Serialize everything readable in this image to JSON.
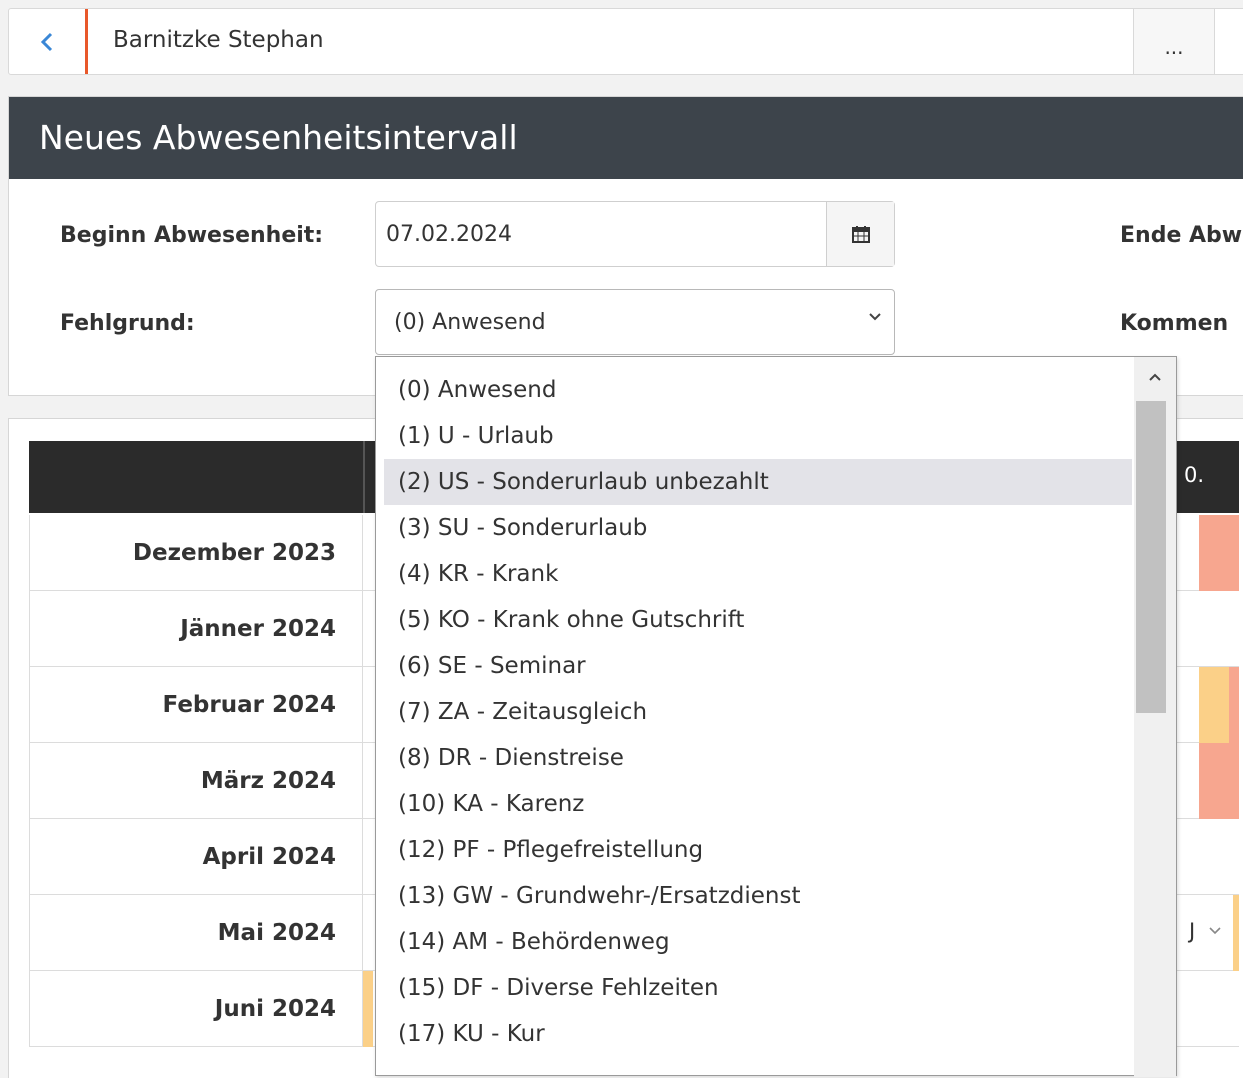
{
  "topbar": {
    "back_icon": "chevron-left-icon",
    "person_name": "Barnitzke Stephan",
    "more_label": "...",
    "accent_color": "#e8582a"
  },
  "dialog": {
    "title": "Neues Abwesenheitsintervall",
    "begin_label": "Beginn Abwesenheit:",
    "begin_value": "07.02.2024",
    "calendar_icon": "calendar-icon",
    "end_label": "Ende Abw",
    "reason_label": "Fehlgrund:",
    "reason_value": "(0) Anwesend",
    "comment_label": "Kommen"
  },
  "table": {
    "header_right_text": "0.",
    "months": [
      {
        "label": "Dezember 2023",
        "color": "#f7a68f"
      },
      {
        "label": "Jänner 2024",
        "color": ""
      },
      {
        "label": "Februar 2024",
        "color": "#fbd088"
      },
      {
        "label": "März 2024",
        "color": "#f7a68f"
      },
      {
        "label": "April 2024",
        "color": ""
      },
      {
        "label": "Mai 2024",
        "color": ""
      },
      {
        "label": "Juni 2024",
        "color": ""
      }
    ],
    "mai_select_text": "J"
  },
  "dropdown": {
    "selected_index": 2,
    "options": [
      "(0) Anwesend",
      "(1) U - Urlaub",
      "(2) US - Sonderurlaub unbezahlt",
      "(3) SU - Sonderurlaub",
      "(4) KR - Krank",
      "(5) KO - Krank ohne Gutschrift",
      "(6) SE - Seminar",
      "(7) ZA - Zeitausgleich",
      "(8) DR - Dienstreise",
      "(10) KA - Karenz",
      "(12) PF - Pflegefreistellung",
      "(13) GW - Grundwehr-/Ersatzdienst",
      "(14) AM - Behördenweg",
      "(15) DF - Diverse Fehlzeiten",
      "(17) KU - Kur"
    ]
  }
}
